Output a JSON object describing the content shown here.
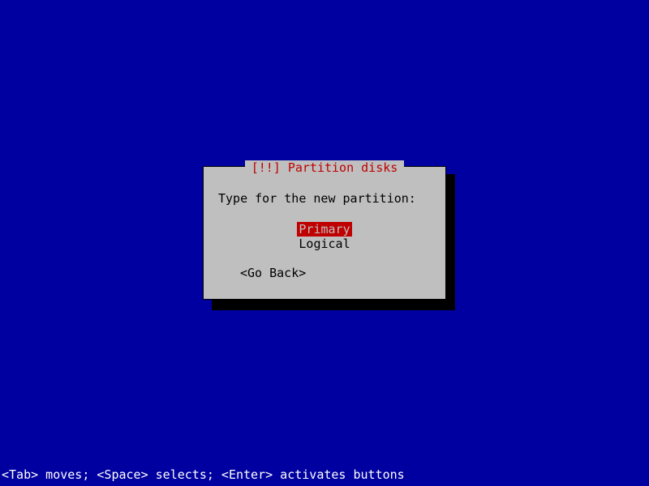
{
  "dialog": {
    "title": "[!!] Partition disks",
    "prompt": "Type for the new partition:",
    "options": [
      {
        "label": "Primary",
        "selected": true
      },
      {
        "label": "Logical",
        "selected": false
      }
    ],
    "go_back": "<Go Back>"
  },
  "status_bar": "<Tab> moves; <Space> selects; <Enter> activates buttons"
}
